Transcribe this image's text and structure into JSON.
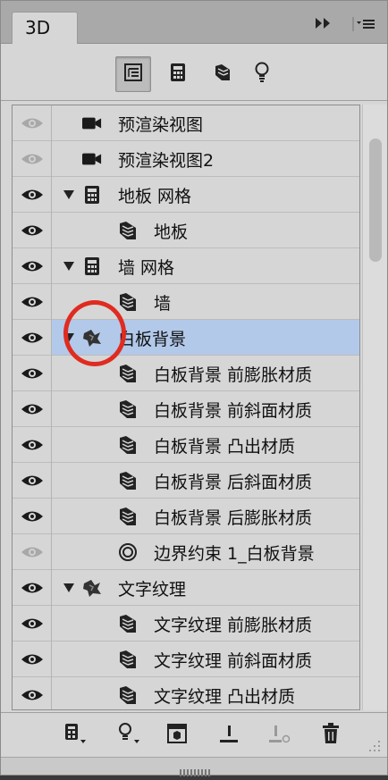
{
  "panel": {
    "tab_label": "3D"
  },
  "layers": [
    {
      "label": "预渲染视图",
      "icon": "camera-icon",
      "visible_dim": true,
      "expand": null,
      "indent": 0,
      "selected": false
    },
    {
      "label": "预渲染视图2",
      "icon": "camera-icon",
      "visible_dim": true,
      "expand": null,
      "indent": 0,
      "selected": false
    },
    {
      "label": "地板 网格",
      "icon": "mesh-icon",
      "visible_dim": false,
      "expand": "expanded",
      "indent": 0,
      "selected": false
    },
    {
      "label": "地板",
      "icon": "material-icon",
      "visible_dim": false,
      "expand": null,
      "indent": 1,
      "selected": false
    },
    {
      "label": "墙 网格",
      "icon": "mesh-icon",
      "visible_dim": false,
      "expand": "expanded",
      "indent": 0,
      "selected": false
    },
    {
      "label": "墙",
      "icon": "material-icon",
      "visible_dim": false,
      "expand": null,
      "indent": 1,
      "selected": false
    },
    {
      "label": "白板背景",
      "icon": "extrusion-icon",
      "visible_dim": false,
      "expand": "expanded",
      "indent": 0,
      "selected": true
    },
    {
      "label": "白板背景 前膨胀材质",
      "icon": "material-icon",
      "visible_dim": false,
      "expand": null,
      "indent": 1,
      "selected": false
    },
    {
      "label": "白板背景 前斜面材质",
      "icon": "material-icon",
      "visible_dim": false,
      "expand": null,
      "indent": 1,
      "selected": false
    },
    {
      "label": "白板背景 凸出材质",
      "icon": "material-icon",
      "visible_dim": false,
      "expand": null,
      "indent": 1,
      "selected": false
    },
    {
      "label": "白板背景 后斜面材质",
      "icon": "material-icon",
      "visible_dim": false,
      "expand": null,
      "indent": 1,
      "selected": false
    },
    {
      "label": "白板背景 后膨胀材质",
      "icon": "material-icon",
      "visible_dim": false,
      "expand": null,
      "indent": 1,
      "selected": false
    },
    {
      "label": "边界约束 1_白板背景",
      "icon": "constraint-icon",
      "visible_dim": true,
      "expand": null,
      "indent": 1,
      "selected": false
    },
    {
      "label": "文字纹理",
      "icon": "extrusion-icon",
      "visible_dim": false,
      "expand": "expanded",
      "indent": 0,
      "selected": false
    },
    {
      "label": "文字纹理 前膨胀材质",
      "icon": "material-icon",
      "visible_dim": false,
      "expand": null,
      "indent": 1,
      "selected": false
    },
    {
      "label": "文字纹理 前斜面材质",
      "icon": "material-icon",
      "visible_dim": false,
      "expand": null,
      "indent": 1,
      "selected": false
    },
    {
      "label": "文字纹理 凸出材质",
      "icon": "material-icon",
      "visible_dim": false,
      "expand": null,
      "indent": 1,
      "selected": false
    }
  ],
  "colors": {
    "panel_bg": "#d6d6d6",
    "selected_row": "#b2c9ea",
    "callout_circle": "#e02b20"
  }
}
